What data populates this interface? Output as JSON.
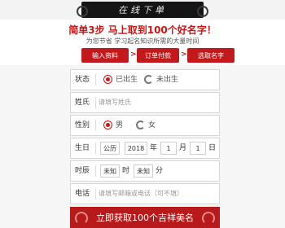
{
  "header": {
    "title": "在线下单"
  },
  "promo": {
    "headline": "简单3步 马上取到100个好名字！",
    "subline": "为您节省 学习起名知识所需的大量时间"
  },
  "steps": [
    {
      "label": "输入资料"
    },
    {
      "label": "订单付款"
    },
    {
      "label": "选取名字"
    }
  ],
  "step_arrow": ">",
  "form": {
    "status": {
      "label": "状态",
      "options": [
        "已出生",
        "未出生"
      ],
      "selected": "已出生"
    },
    "surname": {
      "label": "姓氏",
      "placeholder": "请填写姓氏"
    },
    "gender": {
      "label": "性别",
      "options": [
        "男",
        "女"
      ],
      "selected": "男"
    },
    "birthday": {
      "label": "生日",
      "calendar": "公历",
      "year": "2018",
      "year_unit": "年",
      "month": "1",
      "month_unit": "月",
      "day": "1",
      "day_unit": "日"
    },
    "time": {
      "label": "时辰",
      "hour": "未知",
      "hour_unit": "时",
      "minute": "未知",
      "minute_unit": "分"
    },
    "phone": {
      "label": "电话",
      "placeholder": "请填写邮箱或电话（可不填）"
    }
  },
  "submit": {
    "label": "立即获取100个吉祥美名"
  },
  "colors": {
    "accent": "#c2191c",
    "banner": "#151515"
  }
}
